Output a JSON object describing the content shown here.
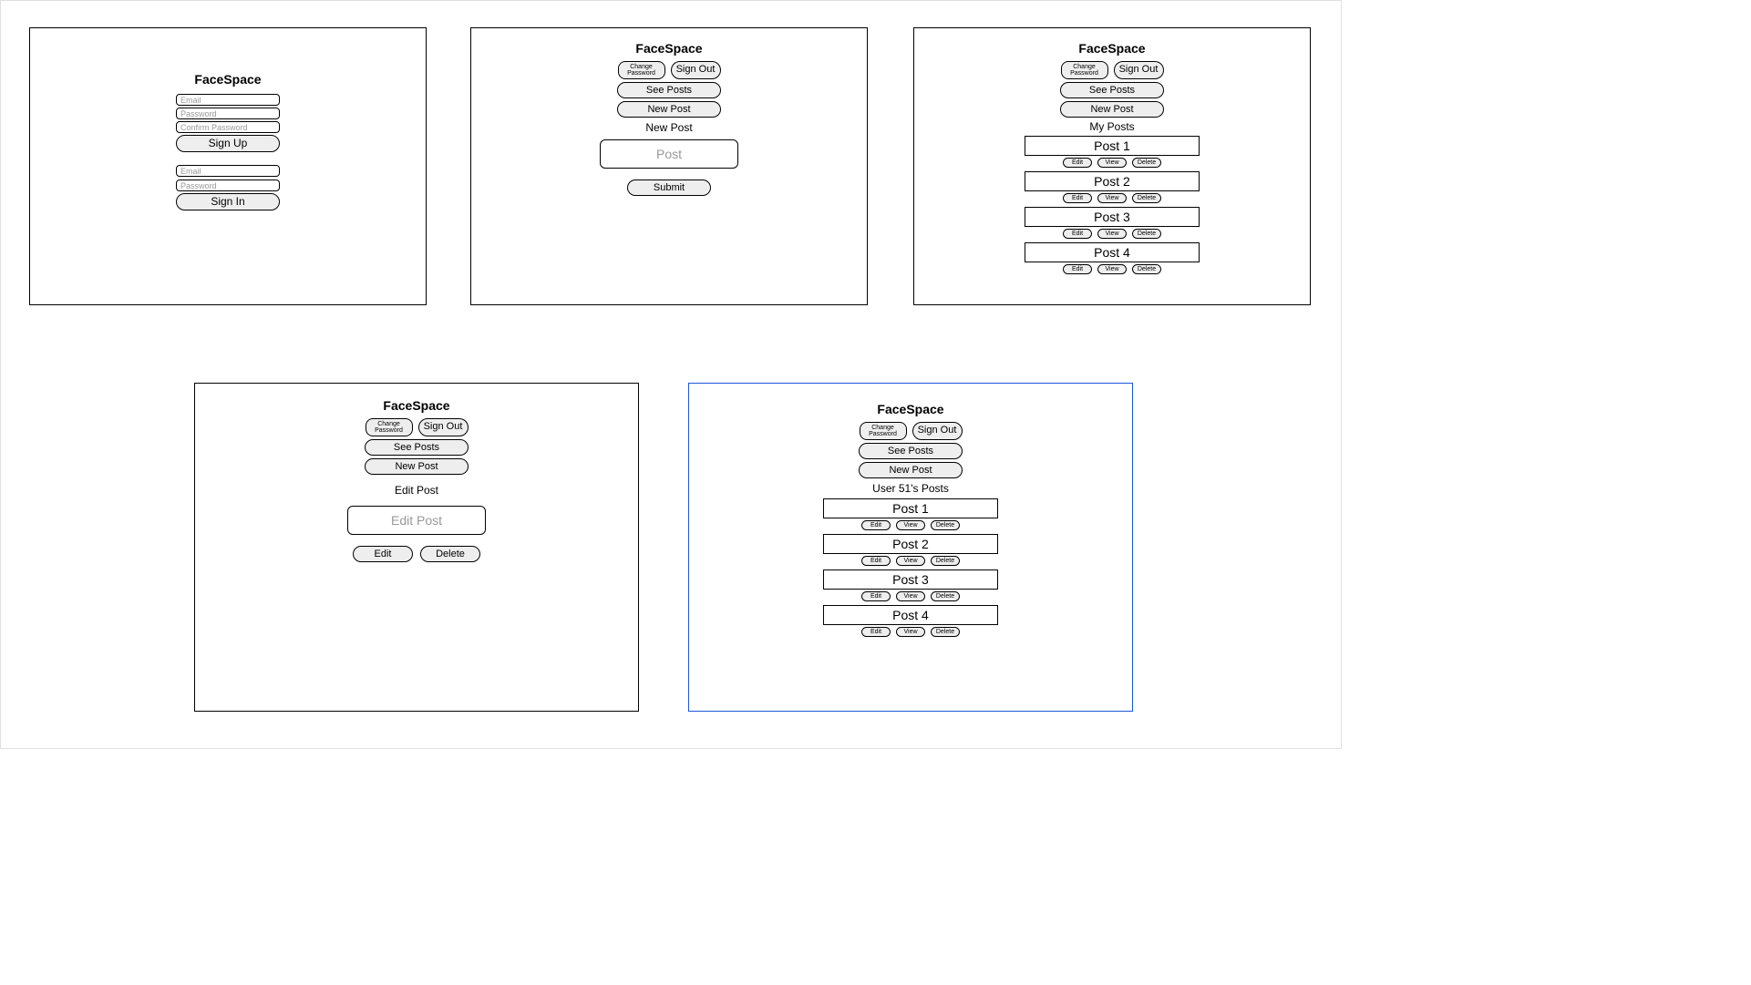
{
  "app_title": "FaceSpace",
  "auth": {
    "signup": {
      "email_placeholder": "Email",
      "password_placeholder": "Password",
      "confirm_password_placeholder": "Confirm Password",
      "submit_label": "Sign Up"
    },
    "signin": {
      "email_placeholder": "Email",
      "password_placeholder": "Password",
      "submit_label": "Sign In"
    }
  },
  "nav": {
    "change_password": "Change Password",
    "sign_out": "Sign Out",
    "see_posts": "See Posts",
    "new_post": "New Post"
  },
  "new_post": {
    "heading": "New Post",
    "placeholder": "Post",
    "submit_label": "Submit"
  },
  "edit_post": {
    "heading": "Edit Post",
    "placeholder": "Edit Post",
    "edit_label": "Edit",
    "delete_label": "Delete"
  },
  "my_posts": {
    "heading": "My Posts",
    "items": [
      {
        "title": "Post 1"
      },
      {
        "title": "Post 2"
      },
      {
        "title": "Post 3"
      },
      {
        "title": "Post 4"
      }
    ],
    "actions": {
      "edit": "Edit",
      "view": "View",
      "delete": "Delete"
    }
  },
  "user_posts": {
    "heading": "User 51's Posts",
    "items": [
      {
        "title": "Post 1"
      },
      {
        "title": "Post 2"
      },
      {
        "title": "Post 3"
      },
      {
        "title": "Post 4"
      }
    ],
    "actions": {
      "edit": "Edit",
      "view": "View",
      "delete": "Delete"
    }
  }
}
